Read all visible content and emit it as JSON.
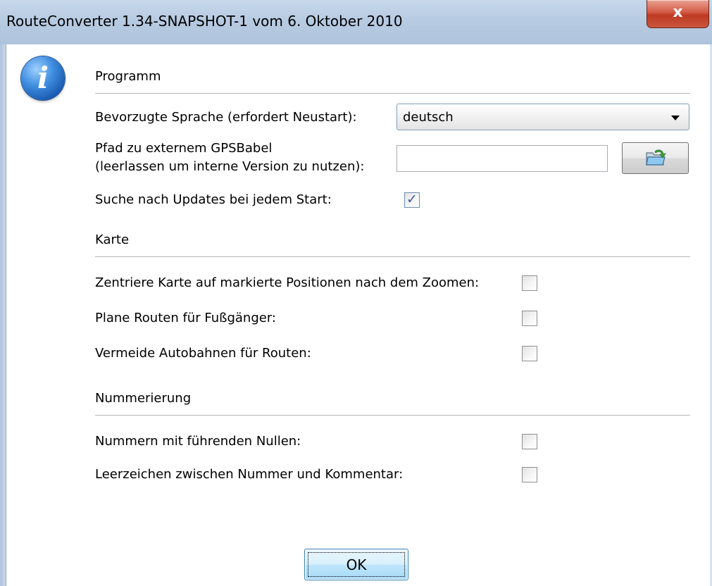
{
  "window": {
    "title": "RouteConverter 1.34-SNAPSHOT-1 vom 6. Oktober 2010",
    "close_label": "x"
  },
  "icon": {
    "name": "info-icon",
    "glyph": "i"
  },
  "program": {
    "heading": "Programm",
    "language_label": "Bevorzugte Sprache (erfordert Neustart):",
    "language_value": "deutsch",
    "gpsbabel_label_line1": "Pfad zu externem GPSBabel",
    "gpsbabel_label_line2": "(leerlassen um interne Version zu nutzen):",
    "gpsbabel_value": "",
    "updates_label": "Suche nach Updates bei jedem Start:",
    "updates_checked": true
  },
  "map": {
    "heading": "Karte",
    "center_label": "Zentriere Karte auf markierte Positionen nach dem Zoomen:",
    "pedestrian_label": "Plane Routen für Fußgänger:",
    "avoid_highways_label": "Vermeide Autobahnen für Routen:"
  },
  "numbering": {
    "heading": "Nummerierung",
    "leading_zeros_label": "Nummern mit führenden Nullen:",
    "space_label": "Leerzeichen zwischen Nummer und Kommentar:"
  },
  "buttons": {
    "ok_label": "OK"
  },
  "checkmark_glyph": "✓",
  "colors": {
    "titlebar": "#b7cbe2",
    "close": "#c9553e",
    "ok_button": "#bee6fd"
  }
}
